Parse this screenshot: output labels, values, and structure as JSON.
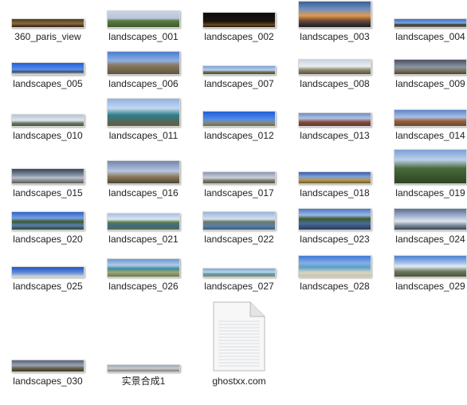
{
  "files": [
    {
      "name": "360_paris_view",
      "thumb": "night-city"
    },
    {
      "name": "landscapes_001",
      "thumb": "green-hills"
    },
    {
      "name": "landscapes_002",
      "thumb": "night-lights"
    },
    {
      "name": "landscapes_003",
      "thumb": "sunset"
    },
    {
      "name": "landscapes_004",
      "thumb": "blue-horizon"
    },
    {
      "name": "landscapes_005",
      "thumb": "blue-flat"
    },
    {
      "name": "landscapes_006",
      "thumb": "mountain"
    },
    {
      "name": "landscapes_007",
      "thumb": "plain"
    },
    {
      "name": "landscapes_008",
      "thumb": "cloudy-plain"
    },
    {
      "name": "landscapes_009",
      "thumb": "dark-cloud"
    },
    {
      "name": "landscapes_010",
      "thumb": "grey-hills"
    },
    {
      "name": "landscapes_011",
      "thumb": "coast"
    },
    {
      "name": "landscapes_012",
      "thumb": "blue-sky-plain"
    },
    {
      "name": "landscapes_013",
      "thumb": "red-earth"
    },
    {
      "name": "landscapes_014",
      "thumb": "red-earth-2"
    },
    {
      "name": "landscapes_015",
      "thumb": "stormy"
    },
    {
      "name": "landscapes_016",
      "thumb": "wide-dry"
    },
    {
      "name": "landscapes_017",
      "thumb": "grey-plain"
    },
    {
      "name": "landscapes_018",
      "thumb": "golden-field"
    },
    {
      "name": "landscapes_019",
      "thumb": "forest-view"
    },
    {
      "name": "landscapes_020",
      "thumb": "lake-trees"
    },
    {
      "name": "landscapes_021",
      "thumb": "lake-hills"
    },
    {
      "name": "landscapes_022",
      "thumb": "water-flat"
    },
    {
      "name": "landscapes_023",
      "thumb": "lake-reflection"
    },
    {
      "name": "landscapes_024",
      "thumb": "pier"
    },
    {
      "name": "landscapes_025",
      "thumb": "sea-sky"
    },
    {
      "name": "landscapes_026",
      "thumb": "shore-green"
    },
    {
      "name": "landscapes_027",
      "thumb": "bay"
    },
    {
      "name": "landscapes_028",
      "thumb": "beach"
    },
    {
      "name": "landscapes_029",
      "thumb": "town-clouds"
    },
    {
      "name": "landscapes_030",
      "thumb": "dusk-town"
    },
    {
      "name": "实景合成1",
      "thumb": "thin-strip"
    },
    {
      "name": "ghostxx.com",
      "thumb": "document-icon"
    }
  ]
}
